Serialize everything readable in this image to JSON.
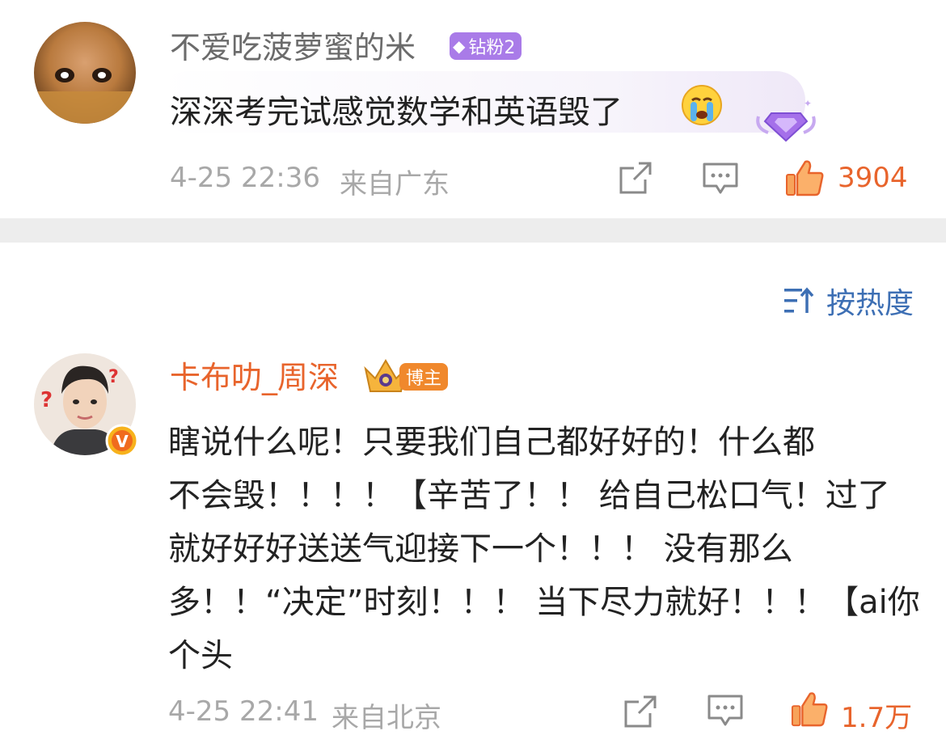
{
  "colors": {
    "accent": "#e8642c",
    "link_blue": "#3d6fb4",
    "divider": "#ededed",
    "diamond_purple": "#a97be8",
    "blogger_orange": "#f0882c"
  },
  "comment1": {
    "username": "不爱吃菠萝蜜的米",
    "badge": "钻粉2",
    "text": "深深考完试感觉数学和英语毁了",
    "emoji": "crying-face-icon",
    "timestamp": "4-25 22:36",
    "location": "来自广东",
    "likes": "3904"
  },
  "sort": {
    "label": "按热度"
  },
  "comment2": {
    "username": "卡布叻_周深",
    "badge": "博主",
    "verified": "V",
    "lines": [
      "瞎说什么呢！只要我们自己都好好的！什么都",
      "不会毁！！！！【辛苦了！！ 给自己松口气！过了",
      "就好好好送送气迎接下一个！！！ 没有那么",
      "多！！“决定”时刻！！！ 当下尽力就好！！！【ai你",
      "个头"
    ],
    "timestamp": "4-25 22:41",
    "location": "来自北京",
    "likes": "1.7万"
  }
}
